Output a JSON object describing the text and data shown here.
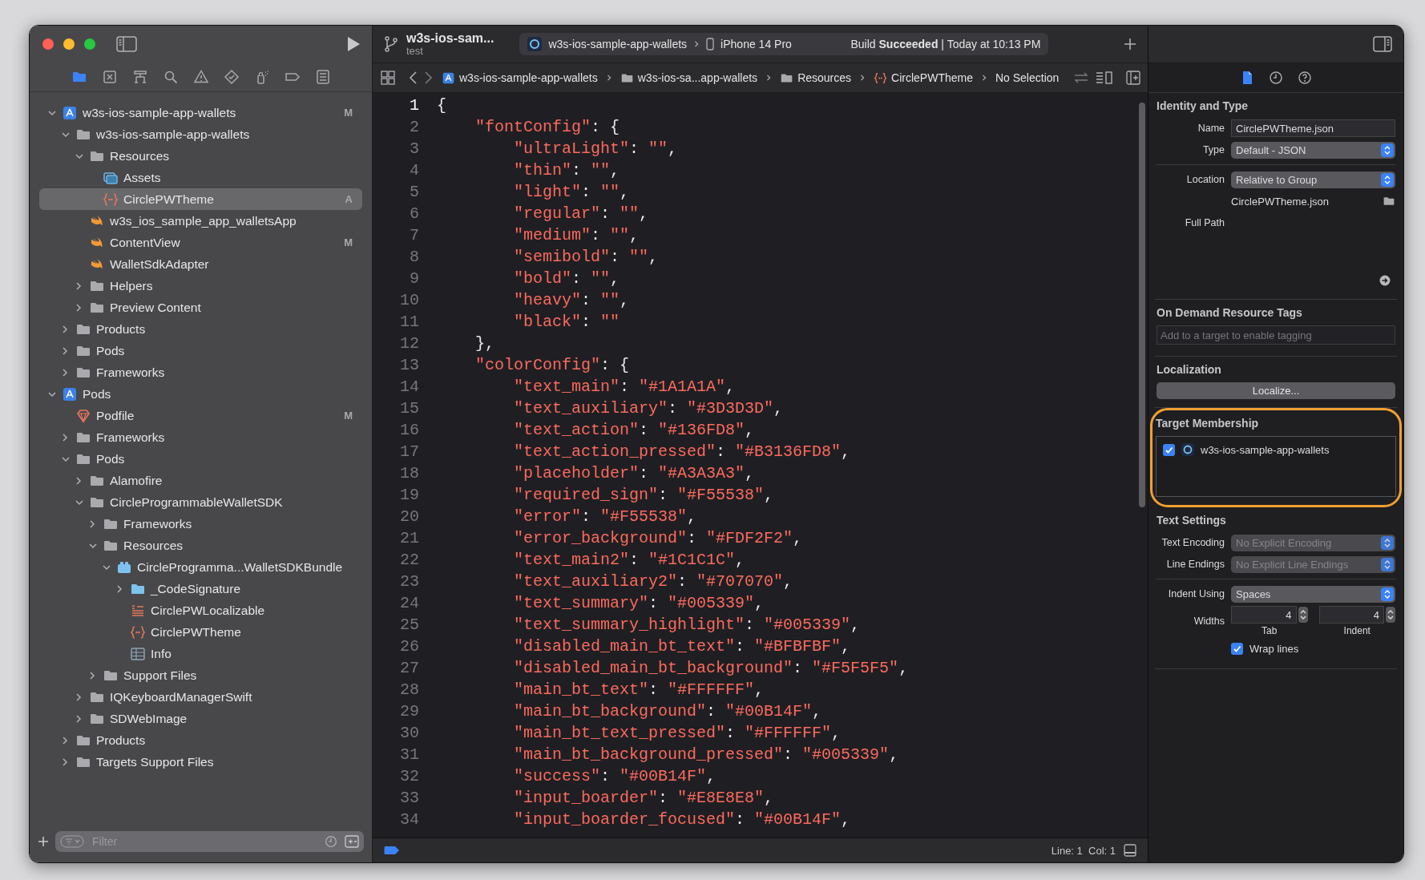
{
  "toolbar": {
    "title": "w3s-ios-sam...",
    "subtitle": "test",
    "scheme": "w3s-ios-sample-app-wallets",
    "device": "iPhone 14 Pro",
    "status": "Build **Succeeded** | Today at 10:13 PM"
  },
  "navigator": {
    "tabs": [
      {
        "kind": "folder",
        "selected": true
      },
      {
        "kind": "xbox",
        "selected": false
      },
      {
        "kind": "hierarchy",
        "selected": false
      },
      {
        "kind": "search",
        "selected": false
      },
      {
        "kind": "warning",
        "selected": false
      },
      {
        "kind": "diamond",
        "selected": false
      },
      {
        "kind": "spray",
        "selected": false
      },
      {
        "kind": "tag",
        "selected": false
      },
      {
        "kind": "list",
        "selected": false
      }
    ],
    "tree": [
      {
        "label": "w3s-ios-sample-app-wallets",
        "kind": "project",
        "expanded": true,
        "selected": false,
        "badge": "M",
        "children": [
          {
            "label": "w3s-ios-sample-app-wallets",
            "kind": "folder",
            "expanded": true,
            "selected": false,
            "children": [
              {
                "label": "Resources",
                "kind": "folder",
                "expanded": true,
                "selected": false,
                "children": [
                  {
                    "label": "Assets",
                    "kind": "assets",
                    "selected": false
                  },
                  {
                    "label": "CirclePWTheme",
                    "kind": "json",
                    "selected": true,
                    "badge": "A"
                  }
                ]
              },
              {
                "label": "w3s_ios_sample_app_walletsApp",
                "kind": "swift",
                "selected": false
              },
              {
                "label": "ContentView",
                "kind": "swift",
                "selected": false,
                "badge": "M"
              },
              {
                "label": "WalletSdkAdapter",
                "kind": "swift",
                "selected": false
              },
              {
                "label": "Helpers",
                "kind": "folder",
                "expanded": false,
                "selected": false
              },
              {
                "label": "Preview Content",
                "kind": "folder",
                "expanded": false,
                "selected": false
              }
            ]
          },
          {
            "label": "Products",
            "kind": "folder",
            "expanded": false,
            "selected": false
          },
          {
            "label": "Pods",
            "kind": "folder",
            "expanded": false,
            "selected": false
          },
          {
            "label": "Frameworks",
            "kind": "folder",
            "expanded": false,
            "selected": false
          }
        ]
      },
      {
        "label": "Pods",
        "kind": "project",
        "expanded": true,
        "selected": false,
        "children": [
          {
            "label": "Podfile",
            "kind": "podfile",
            "selected": false,
            "badge": "M"
          },
          {
            "label": "Frameworks",
            "kind": "folder",
            "expanded": false,
            "selected": false
          },
          {
            "label": "Pods",
            "kind": "folder",
            "expanded": true,
            "selected": false,
            "children": [
              {
                "label": "Alamofire",
                "kind": "folder",
                "expanded": false,
                "selected": false
              },
              {
                "label": "CircleProgrammableWalletSDK",
                "kind": "folder",
                "expanded": true,
                "selected": false,
                "children": [
                  {
                    "label": "Frameworks",
                    "kind": "folder",
                    "expanded": false,
                    "selected": false
                  },
                  {
                    "label": "Resources",
                    "kind": "folder",
                    "expanded": true,
                    "selected": false,
                    "children": [
                      {
                        "label": "CircleProgramma...WalletSDKBundle",
                        "kind": "bundle",
                        "expanded": true,
                        "selected": false,
                        "children": [
                          {
                            "label": "_CodeSignature",
                            "kind": "bluefolder",
                            "expanded": false,
                            "selected": false
                          },
                          {
                            "label": "CirclePWLocalizable",
                            "kind": "strings",
                            "selected": false
                          },
                          {
                            "label": "CirclePWTheme",
                            "kind": "json",
                            "selected": false
                          },
                          {
                            "label": "Info",
                            "kind": "plist",
                            "selected": false
                          }
                        ]
                      }
                    ]
                  },
                  {
                    "label": "Support Files",
                    "kind": "folder",
                    "expanded": false,
                    "selected": false
                  }
                ]
              },
              {
                "label": "IQKeyboardManagerSwift",
                "kind": "folder",
                "expanded": false,
                "selected": false
              },
              {
                "label": "SDWebImage",
                "kind": "folder",
                "expanded": false,
                "selected": false
              }
            ]
          },
          {
            "label": "Products",
            "kind": "folder",
            "expanded": false,
            "selected": false
          },
          {
            "label": "Targets Support Files",
            "kind": "folder",
            "expanded": false,
            "selected": false
          }
        ]
      }
    ],
    "filter": {
      "placeholder": "Filter"
    }
  },
  "jump_bar": [
    {
      "kind": "project",
      "label": "w3s-ios-sample-app-wallets"
    },
    {
      "kind": "folder",
      "label": "w3s-ios-sa...app-wallets"
    },
    {
      "kind": "folder",
      "label": "Resources"
    },
    {
      "kind": "json",
      "label": "CirclePWTheme"
    },
    {
      "kind": "plain",
      "label": "No Selection"
    }
  ],
  "editor": {
    "lines": [
      {
        "number": "1",
        "text": "{",
        "current": true
      },
      {
        "number": "2",
        "text": "    \"fontConfig\": {",
        "current": false
      },
      {
        "number": "3",
        "text": "        \"ultraLight\": \"\",",
        "current": false
      },
      {
        "number": "4",
        "text": "        \"thin\": \"\",",
        "current": false
      },
      {
        "number": "5",
        "text": "        \"light\": \"\",",
        "current": false
      },
      {
        "number": "6",
        "text": "        \"regular\": \"\",",
        "current": false
      },
      {
        "number": "7",
        "text": "        \"medium\": \"\",",
        "current": false
      },
      {
        "number": "8",
        "text": "        \"semibold\": \"\",",
        "current": false
      },
      {
        "number": "9",
        "text": "        \"bold\": \"\",",
        "current": false
      },
      {
        "number": "10",
        "text": "        \"heavy\": \"\",",
        "current": false
      },
      {
        "number": "11",
        "text": "        \"black\": \"\"",
        "current": false
      },
      {
        "number": "12",
        "text": "    },",
        "current": false
      },
      {
        "number": "13",
        "text": "    \"colorConfig\": {",
        "current": false
      },
      {
        "number": "14",
        "text": "        \"text_main\": \"#1A1A1A\",",
        "current": false
      },
      {
        "number": "15",
        "text": "        \"text_auxiliary\": \"#3D3D3D\",",
        "current": false
      },
      {
        "number": "16",
        "text": "        \"text_action\": \"#136FD8\",",
        "current": false
      },
      {
        "number": "17",
        "text": "        \"text_action_pressed\": \"#B3136FD8\",",
        "current": false
      },
      {
        "number": "18",
        "text": "        \"placeholder\": \"#A3A3A3\",",
        "current": false
      },
      {
        "number": "19",
        "text": "        \"required_sign\": \"#F55538\",",
        "current": false
      },
      {
        "number": "20",
        "text": "        \"error\": \"#F55538\",",
        "current": false
      },
      {
        "number": "21",
        "text": "        \"error_background\": \"#FDF2F2\",",
        "current": false
      },
      {
        "number": "22",
        "text": "        \"text_main2\": \"#1C1C1C\",",
        "current": false
      },
      {
        "number": "23",
        "text": "        \"text_auxiliary2\": \"#707070\",",
        "current": false
      },
      {
        "number": "24",
        "text": "        \"text_summary\": \"#005339\",",
        "current": false
      },
      {
        "number": "25",
        "text": "        \"text_summary_highlight\": \"#005339\",",
        "current": false
      },
      {
        "number": "26",
        "text": "        \"disabled_main_bt_text\": \"#BFBFBF\",",
        "current": false
      },
      {
        "number": "27",
        "text": "        \"disabled_main_bt_background\": \"#F5F5F5\",",
        "current": false
      },
      {
        "number": "28",
        "text": "        \"main_bt_text\": \"#FFFFFF\",",
        "current": false
      },
      {
        "number": "29",
        "text": "        \"main_bt_background\": \"#00B14F\",",
        "current": false
      },
      {
        "number": "30",
        "text": "        \"main_bt_text_pressed\": \"#FFFFFF\",",
        "current": false
      },
      {
        "number": "31",
        "text": "        \"main_bt_background_pressed\": \"#005339\",",
        "current": false
      },
      {
        "number": "32",
        "text": "        \"success\": \"#00B14F\",",
        "current": false
      },
      {
        "number": "33",
        "text": "        \"input_boarder\": \"#E8E8E8\",",
        "current": false
      },
      {
        "number": "34",
        "text": "        \"input_boarder_focused\": \"#00B14F\",",
        "current": false
      }
    ],
    "position": "Line: 1  Col: 1"
  },
  "inspector": {
    "tabs": [
      {
        "kind": "file",
        "selected": true
      },
      {
        "kind": "clock",
        "selected": false
      },
      {
        "kind": "help",
        "selected": false
      }
    ],
    "sections": [
      {
        "title": "Identity and Type",
        "highlighted": false,
        "groups": [
          [
            {
              "kind": "text",
              "label": "Name",
              "value": "CirclePWTheme.json"
            },
            {
              "kind": "popup",
              "label": "Type",
              "value": "Default - JSON",
              "disabled": false
            }
          ],
          [
            {
              "kind": "popup",
              "label": "Location",
              "value": "Relative to Group",
              "disabled": false
            },
            {
              "kind": "path",
              "value": "CirclePWTheme.json"
            },
            {
              "kind": "label",
              "label": "Full Path"
            },
            {
              "kind": "reveal"
            }
          ]
        ]
      },
      {
        "title": "On Demand Resource Tags",
        "highlighted": false,
        "groups": [
          [
            {
              "kind": "tags",
              "placeholder": "Add to a target to enable tagging"
            }
          ]
        ]
      },
      {
        "title": "Localization",
        "highlighted": false,
        "groups": [
          [
            {
              "kind": "button",
              "value": "Localize..."
            }
          ]
        ]
      },
      {
        "title": "Target Membership",
        "highlighted": true,
        "groups": [
          [
            {
              "kind": "targets",
              "targets": [
                {
                  "label": "w3s-ios-sample-app-wallets",
                  "checked": true
                }
              ]
            }
          ]
        ]
      },
      {
        "title": "Text Settings",
        "highlighted": false,
        "groups": [
          [
            {
              "kind": "popup",
              "label": "Text Encoding",
              "value": "No Explicit Encoding",
              "disabled": true
            },
            {
              "kind": "popup",
              "label": "Line Endings",
              "value": "No Explicit Line Endings",
              "disabled": true
            }
          ],
          [
            {
              "kind": "popup",
              "label": "Indent Using",
              "value": "Spaces",
              "disabled": false
            },
            {
              "kind": "steppers",
              "label": "Widths",
              "steppers": [
                {
                  "value": "4",
                  "caption": "Tab"
                },
                {
                  "value": "4",
                  "caption": "Indent"
                }
              ]
            },
            {
              "kind": "checkbox",
              "label": "Wrap lines",
              "checked": true
            }
          ]
        ]
      }
    ]
  }
}
